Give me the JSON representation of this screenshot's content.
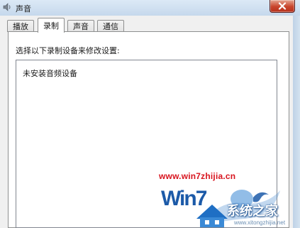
{
  "window": {
    "title": "声音"
  },
  "tabs": [
    {
      "label": "播放",
      "active": false
    },
    {
      "label": "录制",
      "active": true
    },
    {
      "label": "声音",
      "active": false
    },
    {
      "label": "通信",
      "active": false
    }
  ],
  "recording": {
    "instruction": "选择以下录制设备来修改设置:",
    "empty_message": "未安装音频设备"
  },
  "watermark": {
    "url": "www.win7zhijia.cn",
    "logo": "Win7",
    "brand": "系统之家",
    "small_url": "www.xitongzhijia.net"
  },
  "colors": {
    "accent_red": "#d8141e",
    "brand_blue": "#1c5aa8"
  }
}
